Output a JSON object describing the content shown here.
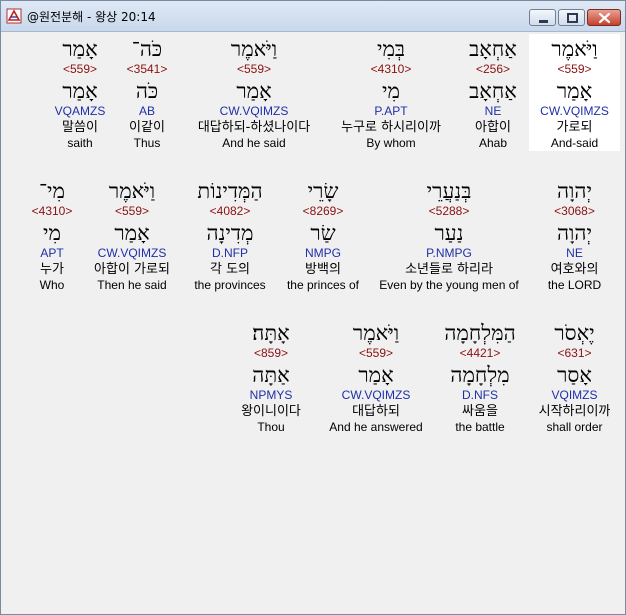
{
  "window": {
    "title": "@원전분해 - 왕상 20:14"
  },
  "rows": [
    {
      "words": [
        {
          "heb": "וַיֹּאמֶר",
          "strong": "<559>",
          "lex": "אָמַר",
          "parse": "CW.VQIMZS",
          "kor": "가로되",
          "eng": "And-said",
          "selected": true
        },
        {
          "heb": "אַחְאָב",
          "strong": "<256>",
          "lex": "אַחְאָב",
          "parse": "NE",
          "kor": "아합이",
          "eng": "Ahab"
        },
        {
          "heb": "בְּמִי",
          "strong": "<4310>",
          "lex": "מִי",
          "parse": "P.APT",
          "kor": "누구로 하시리이까",
          "eng": "By whom"
        },
        {
          "heb": "וַיֹּאמֶר",
          "strong": "<559>",
          "lex": "אָמַר",
          "parse": "CW.VQIMZS",
          "kor": "대답하되-하셨나이다",
          "eng": "And he said"
        },
        {
          "heb": "כֹּה־",
          "strong": "<3541>",
          "lex": "כֹּה",
          "parse": "AB",
          "kor": "이같이",
          "eng": "Thus"
        },
        {
          "heb": "אָמַר",
          "strong": "<559>",
          "lex": "אָמַר",
          "parse": "VQAMZS",
          "kor": "말씀이",
          "eng": "saith"
        }
      ]
    },
    {
      "words": [
        {
          "heb": "יְהוָה",
          "strong": "<3068>",
          "lex": "יְהוָה",
          "parse": "NE",
          "kor": "여호와의",
          "eng": "the LORD"
        },
        {
          "heb": "בְּנַעֲרֵי",
          "strong": "<5288>",
          "lex": "נַעַר",
          "parse": "P.NMPG",
          "kor": "소년들로 하리라",
          "eng": "Even by the young men of"
        },
        {
          "heb": "שָׂרֵי",
          "strong": "<8269>",
          "lex": "שַׂר",
          "parse": "NMPG",
          "kor": "방백의",
          "eng": "the princes of"
        },
        {
          "heb": "הַמְּדִינוֹת",
          "strong": "<4082>",
          "lex": "מְדִינָה",
          "parse": "D.NFP",
          "kor": "각 도의",
          "eng": "the provinces"
        },
        {
          "heb": "וַיֹּאמֶר",
          "strong": "<559>",
          "lex": "אָמַר",
          "parse": "CW.VQIMZS",
          "kor": "아합이 가로되",
          "eng": "Then he said"
        },
        {
          "heb": "מִי־",
          "strong": "<4310>",
          "lex": "מִי",
          "parse": "APT",
          "kor": "누가",
          "eng": "Who"
        }
      ]
    },
    {
      "words": [
        {
          "heb": "יֶאְסֹר",
          "strong": "<631>",
          "lex": "אָסַר",
          "parse": "VQIMZS",
          "kor": "시작하리이까",
          "eng": "shall order"
        },
        {
          "heb": "הַמִּלְחָמָה",
          "strong": "<4421>",
          "lex": "מִלְחָמָה",
          "parse": "D.NFS",
          "kor": "싸움을",
          "eng": "the battle"
        },
        {
          "heb": "וַיֹּאמֶר",
          "strong": "<559>",
          "lex": "אָמַר",
          "parse": "CW.VQIMZS",
          "kor": "대답하되",
          "eng": "And he answered"
        },
        {
          "heb": "אָתָּה׃",
          "strong": "<859>",
          "lex": "אַתָּה",
          "parse": "NPMYS",
          "kor": "왕이니이다",
          "eng": "Thou"
        }
      ]
    }
  ]
}
